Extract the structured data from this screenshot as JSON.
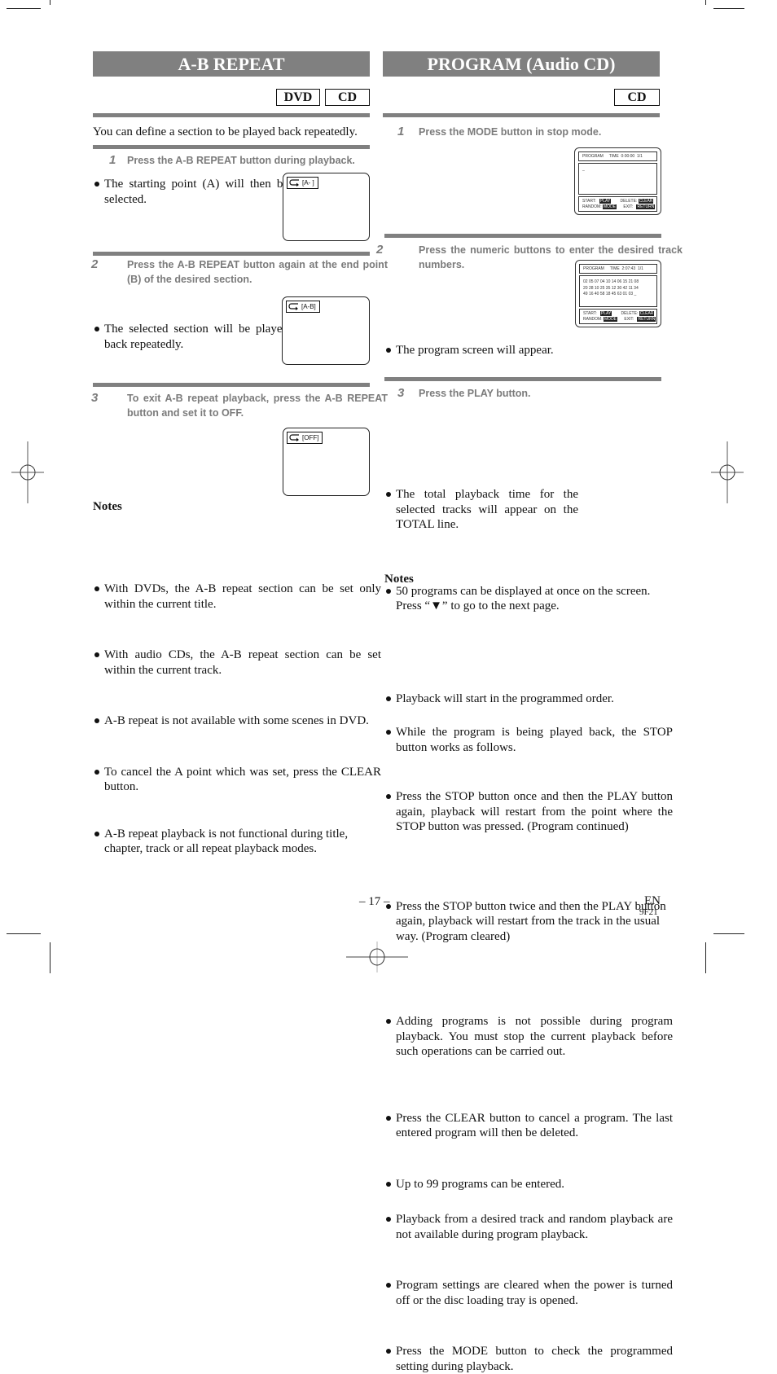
{
  "left": {
    "title": "A-B REPEAT",
    "tags": [
      "DVD",
      "CD"
    ],
    "intro": "You can define a section to be played back repeatedly.",
    "steps": [
      {
        "number": "1",
        "instruction": "Press the A-B REPEAT button during playback.",
        "bullets": [
          "The starting point (A) will then be selected."
        ],
        "osd_label": "[A-   ]",
        "osd_icon": "repeat-arrow-icon"
      },
      {
        "number": "2",
        "instruction": "Press the A-B REPEAT button again at the end point (B) of the desired section.",
        "bullets": [
          "The selected section will be played back repeatedly."
        ],
        "osd_label": "[A-B]",
        "osd_icon": "repeat-arrow-icon"
      },
      {
        "number": "3",
        "instruction": "To exit A-B repeat playback, press the A-B REPEAT button and set it to OFF.",
        "bullets": [],
        "osd_label": "[OFF]",
        "osd_icon": "repeat-arrow-icon"
      }
    ],
    "notes_title": "Notes",
    "notes": [
      "With DVDs, the A-B repeat section can be set only within the current title.",
      "With audio CDs, the A-B repeat section can be set within the current track.",
      "A-B repeat is not available with some scenes in DVD.",
      "To cancel the A point which was set, press the CLEAR button.",
      "A-B repeat playback is not functional during title, chapter, track or all repeat playback modes."
    ]
  },
  "right": {
    "title": "PROGRAM (Audio CD)",
    "tags": [
      "CD"
    ],
    "steps": [
      {
        "number": "1",
        "instruction": "Press the MODE button in stop mode.",
        "bullets": [
          "The program screen will appear."
        ]
      },
      {
        "number": "2",
        "instruction": "Press the numeric buttons to enter the desired track numbers.",
        "bullets": [
          "The total playback time for the selected tracks will appear on the TOTAL line.",
          "50 programs can be displayed at once on the screen. Press “▼” to go to the next page."
        ]
      },
      {
        "number": "3",
        "instruction": "Press the PLAY button.",
        "bullets": [
          "Playback will start in the programmed order.",
          "While the program is being played back, the STOP button works as follows.",
          "Press the STOP button once and then the PLAY button again, playback will restart from the point where the STOP button was pressed. (Program continued)",
          "Press the STOP button twice and then the PLAY button again, playback will restart from the track in the usual way. (Program cleared)"
        ]
      }
    ],
    "program_screens": [
      {
        "header_label": "PROGRAM",
        "time_label": "TIME",
        "time_value": "0:00:00",
        "page": "1/1",
        "rows": [
          "_"
        ],
        "start_label": "START:",
        "start_key": "PLAY",
        "delete_label": "DELETE:",
        "delete_key": "CLEAR",
        "random_label": "RANDOM:",
        "random_key": "MODE",
        "exit_label": "EXIT:",
        "exit_key": "RETURN"
      },
      {
        "header_label": "PROGRAM",
        "time_label": "TIME",
        "time_value": "2:07:43",
        "page": "1/1",
        "rows": [
          "02 05 07 04 10 14 06 15 21 08",
          "20 28 10 25 35 12 30 42 11 34",
          "49 16 40 58 18 45 63 01 03  _"
        ],
        "start_label": "START:",
        "start_key": "PLAY",
        "delete_label": "DELETE:",
        "delete_key": "CLEAR",
        "random_label": "RANDOM:",
        "random_key": "MODE",
        "exit_label": "EXIT:",
        "exit_key": "RETURN"
      }
    ],
    "notes_title": "Notes",
    "notes": [
      "Adding programs is not possible during program playback. You must stop the current playback before such operations can be carried out.",
      "Press the CLEAR button to cancel a program. The last entered program will then be deleted.",
      "Up to 99 programs can be entered.",
      "Playback from a desired track and random playback are not available during program playback.",
      "Program settings are cleared when the power is turned off or the disc loading tray is opened.",
      "Press the MODE button to check the programmed setting during playback."
    ]
  },
  "footer": {
    "page_number": "– 17 –",
    "language": "EN",
    "code": "9F21"
  }
}
